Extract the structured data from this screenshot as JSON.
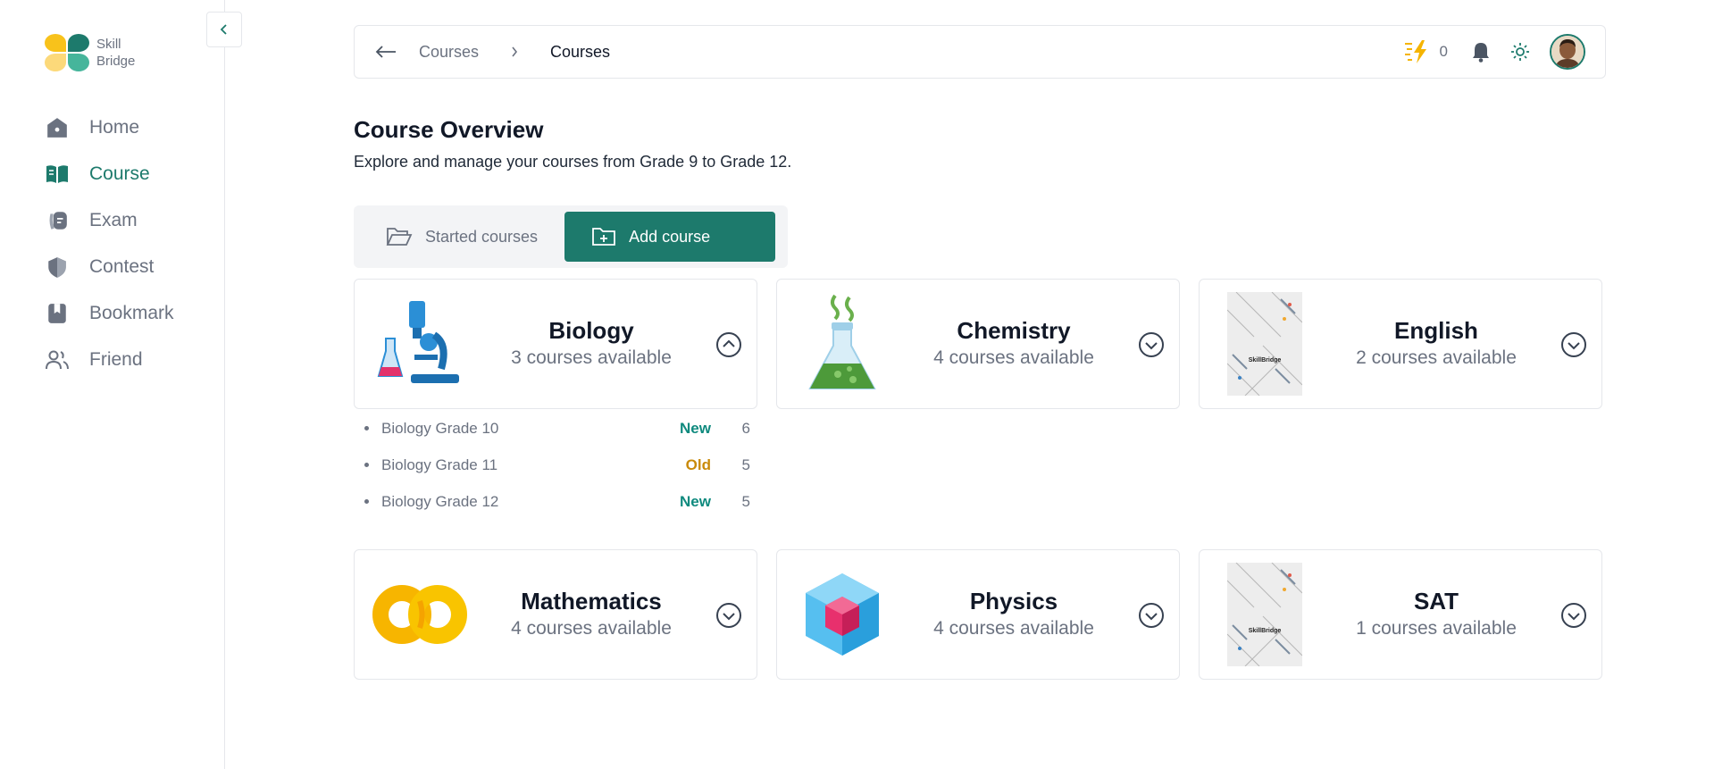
{
  "brand": {
    "line1": "Skill",
    "line2": "Bridge"
  },
  "sidebar": {
    "items": [
      {
        "label": "Home",
        "icon": "home-icon"
      },
      {
        "label": "Course",
        "icon": "book-icon",
        "active": true
      },
      {
        "label": "Exam",
        "icon": "exam-icon"
      },
      {
        "label": "Contest",
        "icon": "shield-icon"
      },
      {
        "label": "Bookmark",
        "icon": "bookmark-icon"
      },
      {
        "label": "Friend",
        "icon": "friends-icon"
      }
    ]
  },
  "topbar": {
    "crumb_parent": "Courses",
    "crumb_current": "Courses",
    "energy_count": "0"
  },
  "page": {
    "title": "Course Overview",
    "subtitle": "Explore and manage your courses from Grade 9 to Grade 12."
  },
  "tabs": {
    "started": "Started courses",
    "add": "Add course"
  },
  "cards": [
    {
      "name": "Biology",
      "available": "3 courses available",
      "expanded": true
    },
    {
      "name": "Chemistry",
      "available": "4 courses available"
    },
    {
      "name": "English",
      "available": "2 courses available"
    },
    {
      "name": "Mathematics",
      "available": "4 courses available"
    },
    {
      "name": "Physics",
      "available": "4 courses available"
    },
    {
      "name": "SAT",
      "available": "1 courses available"
    }
  ],
  "biology_courses": [
    {
      "label": "Biology Grade 10",
      "status": "New",
      "count": "6"
    },
    {
      "label": "Biology Grade 11",
      "status": "Old",
      "count": "5"
    },
    {
      "label": "Biology Grade 12",
      "status": "New",
      "count": "5"
    }
  ],
  "colors": {
    "accent": "#1d7a6c",
    "new_badge": "#0f8a7e",
    "old_badge": "#c98a0a",
    "energy": "#f5b400"
  },
  "thumbnail_brand": "SkillBridge"
}
